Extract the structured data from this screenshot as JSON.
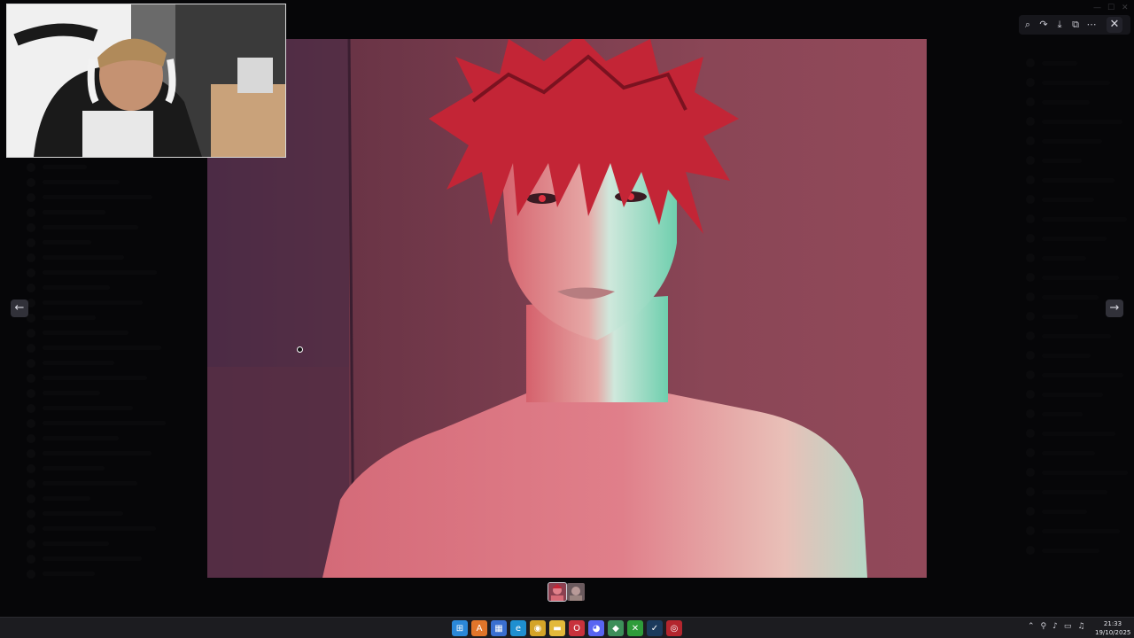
{
  "taskbar": {
    "time": "21:33",
    "date": "19/10/2025",
    "apps": [
      {
        "name": "start-icon",
        "color": "#2b88d8",
        "glyph": "⊞"
      },
      {
        "name": "app-orange-icon",
        "color": "#e0752a",
        "glyph": "A"
      },
      {
        "name": "calendar-app-icon",
        "color": "#3a6fd0",
        "glyph": "▦"
      },
      {
        "name": "edge-browser-icon",
        "color": "#1f8fd0",
        "glyph": "e"
      },
      {
        "name": "chrome-browser-icon",
        "color": "#d4a428",
        "glyph": "◉"
      },
      {
        "name": "file-explorer-icon",
        "color": "#e3b93a",
        "glyph": "▬"
      },
      {
        "name": "opera-browser-icon",
        "color": "#c8323c",
        "glyph": "O"
      },
      {
        "name": "discord-app-icon",
        "color": "#5865f2",
        "glyph": "◕"
      },
      {
        "name": "app-green-icon",
        "color": "#3d8f5a",
        "glyph": "◆"
      },
      {
        "name": "xbox-app-icon",
        "color": "#2e9c3a",
        "glyph": "✕"
      },
      {
        "name": "steam-app-icon",
        "color": "#1b3a5c",
        "glyph": "✓"
      },
      {
        "name": "app-red-icon",
        "color": "#b3262e",
        "glyph": "◎"
      }
    ]
  },
  "viewer": {
    "toolbar": [
      "zoom-icon",
      "forward-icon",
      "download-icon",
      "open-external-icon",
      "more-icon"
    ],
    "glyphs": {
      "zoom": "⌕",
      "forward": "↷",
      "download": "⤓",
      "open": "⧉",
      "more": "⋯",
      "close": "✕",
      "left": "←",
      "right": "→"
    }
  },
  "colors": {
    "skin": "#d6646e",
    "hair": "#c92b3a",
    "background_wall": "#7a3c4c",
    "cyan_light": "#7fd6b8"
  }
}
